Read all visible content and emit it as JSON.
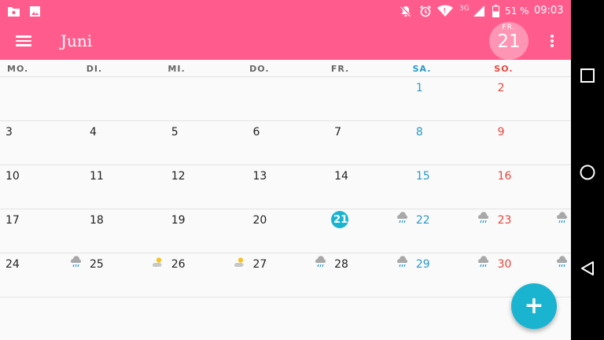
{
  "status_bar": {
    "battery": "51 %",
    "time": "09:03",
    "network": "3G",
    "icons": [
      "photo-folder-icon",
      "image-icon",
      "mute-icon",
      "alarm-icon",
      "wifi-icon",
      "signal-icon",
      "battery-icon"
    ]
  },
  "app_bar": {
    "title": "Juni",
    "today_dow": "FR.",
    "today_day": "21"
  },
  "weekdays": [
    "MO.",
    "DI.",
    "MI.",
    "DO.",
    "FR.",
    "SA.",
    "SO."
  ],
  "weeks": [
    [
      null,
      null,
      null,
      null,
      null,
      "1",
      "2"
    ],
    [
      "3",
      "4",
      "5",
      "6",
      "7",
      "8",
      "9"
    ],
    [
      "10",
      "11",
      "12",
      "13",
      "14",
      "15",
      "16"
    ],
    [
      "17",
      "18",
      "19",
      "20",
      "21",
      "22",
      "23"
    ],
    [
      "24",
      "25",
      "26",
      "27",
      "28",
      "29",
      "30"
    ]
  ],
  "today": "21",
  "weather": {
    "22": "rain-cloud-icon",
    "23": "rain-cloud-icon",
    "24": "rain-cloud-icon",
    "25": "rain-cloud-icon",
    "26": "partly-sunny-icon",
    "27": "partly-sunny-icon",
    "28": "rain-cloud-icon",
    "29": "rain-cloud-icon",
    "30": "rain-cloud-icon"
  },
  "fab": {
    "label": "+"
  },
  "colors": {
    "primary": "#ff5c8d",
    "accent": "#1ab4d0",
    "saturday": "#2a98c8",
    "sunday": "#e5473f"
  }
}
